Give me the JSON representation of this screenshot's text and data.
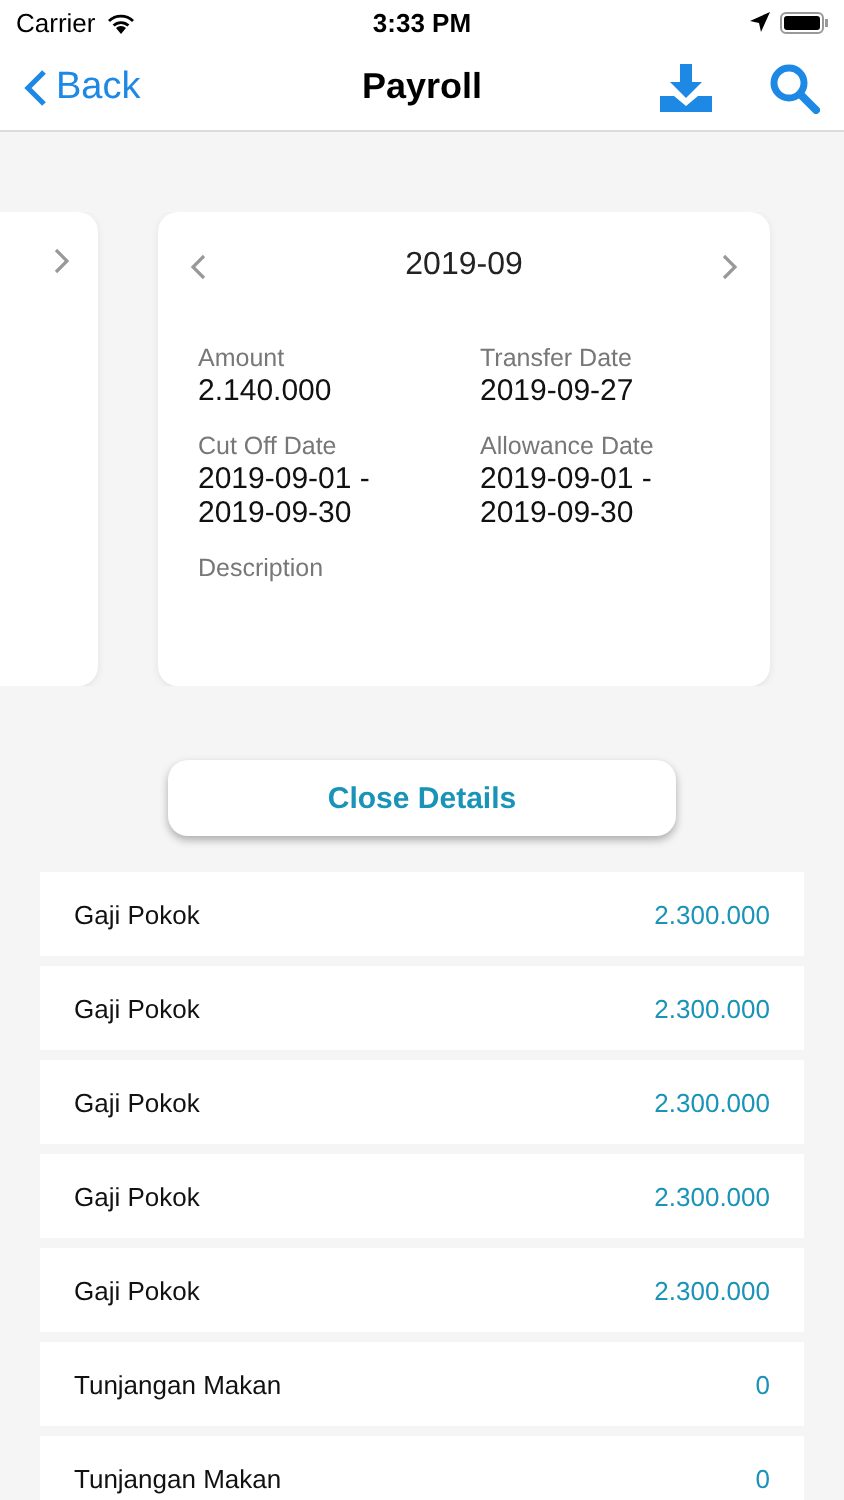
{
  "status_bar": {
    "carrier": "Carrier",
    "time": "3:33 PM"
  },
  "nav": {
    "back": "Back",
    "title": "Payroll"
  },
  "period_card": {
    "period": "2019-09",
    "fields": [
      {
        "label": "Amount",
        "value": "2.140.000"
      },
      {
        "label": "Transfer Date",
        "value": "2019-09-27"
      },
      {
        "label": "Cut Off Date",
        "value": "2019-09-01 - 2019-09-30"
      },
      {
        "label": "Allowance Date",
        "value": "2019-09-01 - 2019-09-30"
      },
      {
        "label": "Description"
      }
    ]
  },
  "close_button": "Close Details",
  "items": [
    {
      "name": "Gaji Pokok",
      "amount": "2.300.000"
    },
    {
      "name": "Gaji Pokok",
      "amount": "2.300.000"
    },
    {
      "name": "Gaji Pokok",
      "amount": "2.300.000"
    },
    {
      "name": "Gaji Pokok",
      "amount": "2.300.000"
    },
    {
      "name": "Gaji Pokok",
      "amount": "2.300.000"
    },
    {
      "name": "Tunjangan Makan",
      "amount": "0"
    },
    {
      "name": "Tunjangan Makan",
      "amount": "0"
    }
  ]
}
